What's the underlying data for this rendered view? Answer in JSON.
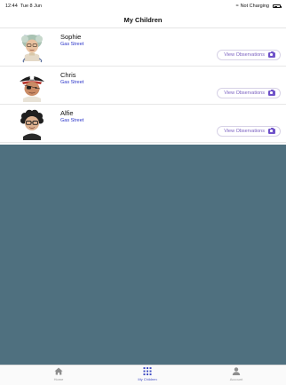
{
  "status_bar": {
    "time": "12:44",
    "date": "Tue 8 Jun",
    "wifi_icon": "wifi-icon",
    "charging_text": "Not Charging",
    "battery_icon": "battery-icon"
  },
  "header": {
    "title": "My Children"
  },
  "children": [
    {
      "name": "Sophie",
      "school": "Gas Street",
      "button_label": "View Observations",
      "avatar": "sophie-avatar"
    },
    {
      "name": "Chris",
      "school": "Gas Street",
      "button_label": "View Observations",
      "avatar": "pirate-avatar"
    },
    {
      "name": "Alfie",
      "school": "Gas Street",
      "button_label": "View Observations",
      "avatar": "alfie-avatar"
    }
  ],
  "tabs": [
    {
      "label": "Home",
      "icon": "home-icon",
      "active": false
    },
    {
      "label": "My Children",
      "icon": "grid-icon",
      "active": true
    },
    {
      "label": "Account",
      "icon": "person-icon",
      "active": false
    }
  ],
  "colors": {
    "accent": "#4450c4",
    "school_text": "#2b35c9",
    "button_text": "#7a5fc0",
    "camera": "#6f52c9",
    "empty_area": "#4f707f"
  }
}
